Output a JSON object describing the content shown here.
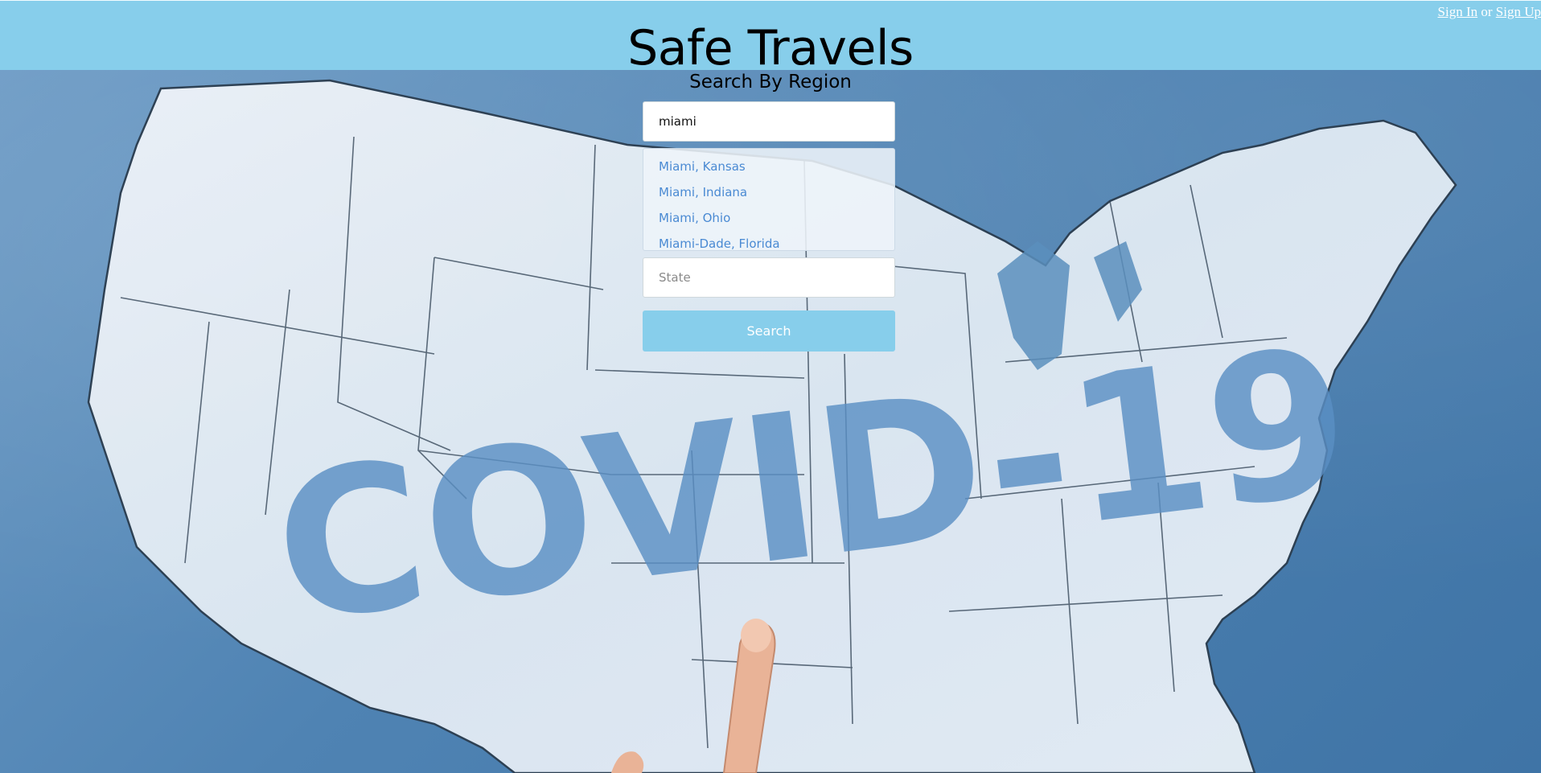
{
  "header": {
    "title": "Safe Travels",
    "auth": {
      "sign_in_label": "Sign In",
      "separator": "or",
      "sign_up_label": "Sign Up"
    },
    "background_color": "#87ceeb"
  },
  "search": {
    "subtitle": "Search By Region",
    "city_value": "miami",
    "state_placeholder": "State",
    "suggestions": [
      {
        "label": "Miami, Kansas"
      },
      {
        "label": "Miami, Indiana"
      },
      {
        "label": "Miami, Ohio"
      },
      {
        "label": "Miami-Dade, Florida"
      }
    ],
    "button_label": "Search",
    "suggestion_color": "#4a8ad3"
  },
  "background": {
    "overlay_text": "COVID-19",
    "icons": [
      "us-map-image",
      "pointing-finger-image"
    ]
  }
}
